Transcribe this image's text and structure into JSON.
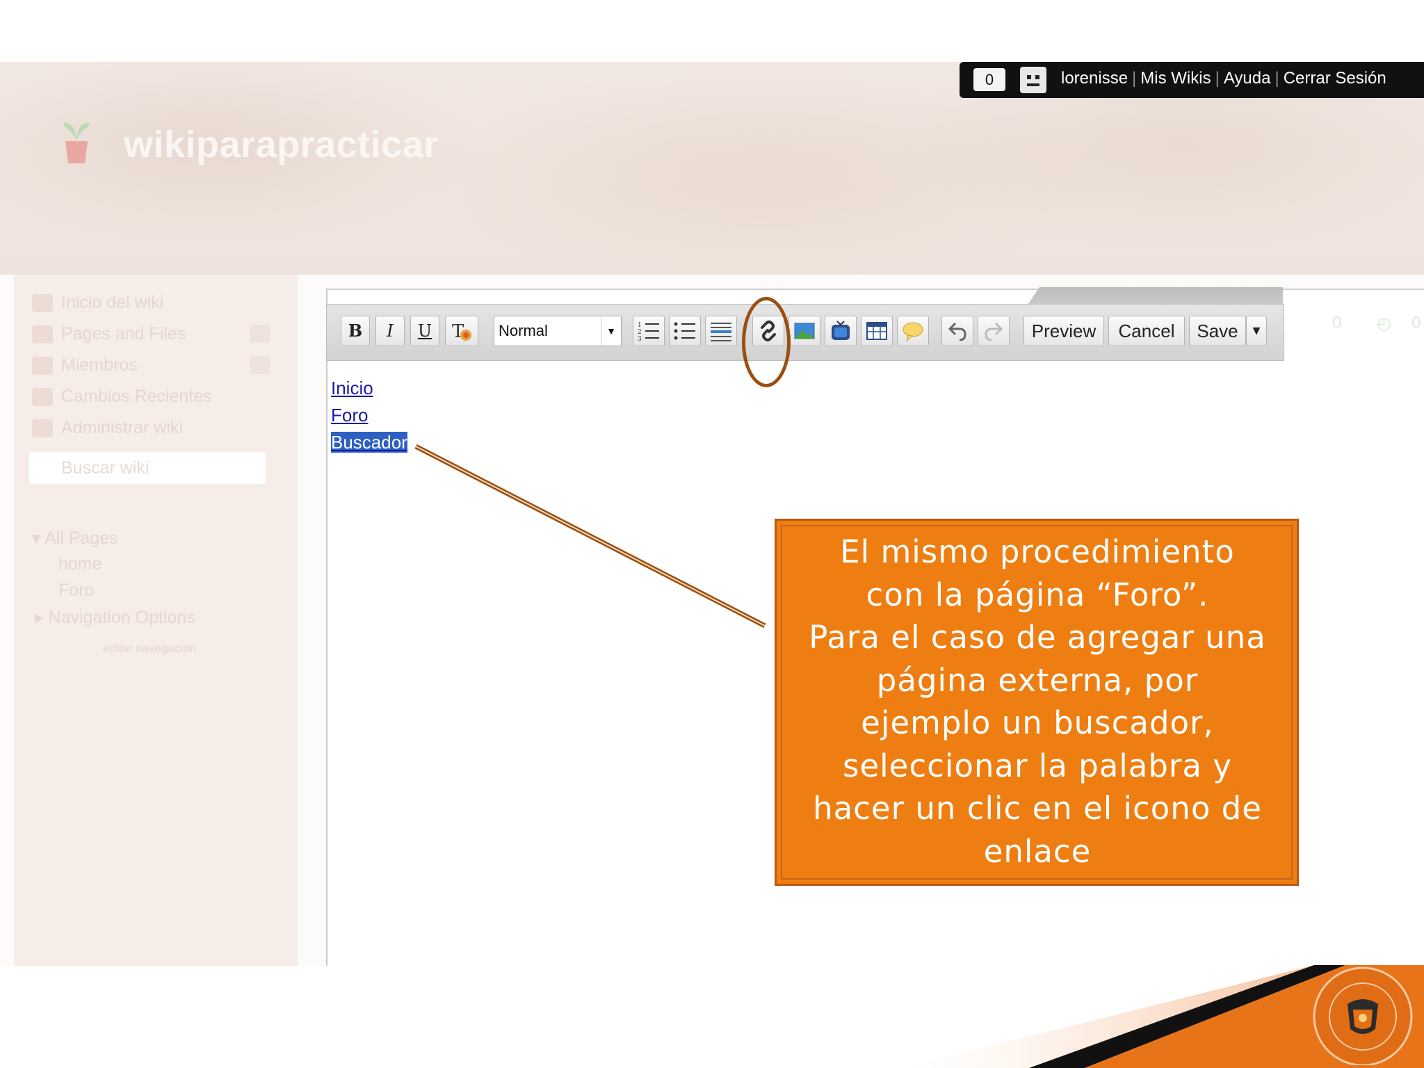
{
  "site": {
    "title": "wikiparapracticar"
  },
  "userbar": {
    "count": "0",
    "links": [
      "lorenisse",
      "Mis Wikis",
      "Ayuda",
      "Cerrar Sesión"
    ]
  },
  "sidebar": {
    "items": [
      {
        "label": "Inicio del wiki"
      },
      {
        "label": "Pages and Files"
      },
      {
        "label": "Miembros"
      },
      {
        "label": "Cambios Recientes"
      },
      {
        "label": "Administrar wiki"
      }
    ],
    "search_placeholder": "Buscar wiki",
    "tree": {
      "all_pages": "All Pages",
      "pages": [
        "home",
        "Foro"
      ],
      "nav_options": "Navigation Options",
      "edit_nav": "editar navegación"
    }
  },
  "toolbar": {
    "bold": "B",
    "italic": "I",
    "underline": "U",
    "format_value": "Normal",
    "preview": "Preview",
    "cancel": "Cancel",
    "save": "Save"
  },
  "editor": {
    "links": [
      "Inicio",
      "Foro",
      "Buscador"
    ],
    "faint_counts": [
      "0",
      "0"
    ]
  },
  "callout": {
    "text": "El mismo procedimiento con la página “Foro”. Para el caso de agregar una página externa, por ejemplo un buscador, seleccionar la palabra y hacer un clic en el icono de enlace",
    "lines": [
      "El mismo procedimiento",
      "con la página “Foro”.",
      "Para el caso de agregar una",
      "página externa, por",
      "ejemplo un buscador,",
      "seleccionar la palabra y",
      "hacer un clic en el icono de",
      "enlace"
    ]
  },
  "colors": {
    "callout_bg": "#ef7e12",
    "highlight": "#9a4f12",
    "selection": "#2e5fc2"
  },
  "icons": [
    "link-icon",
    "image-icon",
    "video-icon",
    "table-icon",
    "comment-icon",
    "undo-icon",
    "redo-icon",
    "ordered-list-icon",
    "unordered-list-icon",
    "horizontal-rule-icon",
    "text-color-icon"
  ]
}
